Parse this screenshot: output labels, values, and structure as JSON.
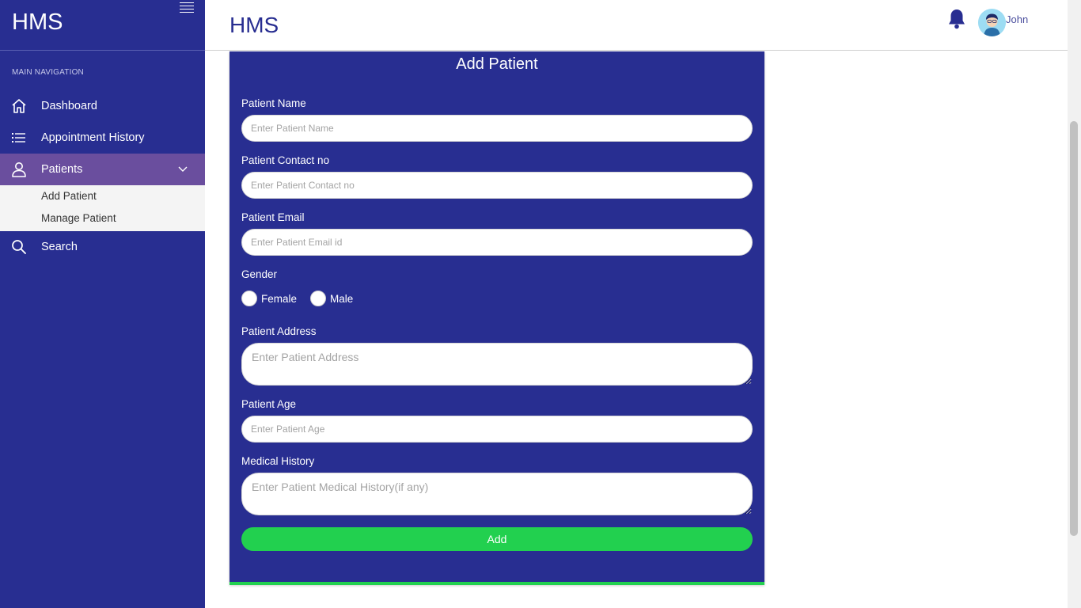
{
  "app": {
    "brand": "HMS",
    "page_title": "HMS"
  },
  "sidebar": {
    "heading": "MAIN NAVIGATION",
    "items": [
      {
        "label": "Dashboard",
        "icon": "home-icon"
      },
      {
        "label": "Appointment History",
        "icon": "list-icon"
      },
      {
        "label": "Patients",
        "icon": "user-icon",
        "active": true
      },
      {
        "label": "Search",
        "icon": "search-icon"
      }
    ],
    "submenu": [
      {
        "label": "Add Patient"
      },
      {
        "label": "Manage Patient"
      }
    ]
  },
  "header": {
    "username": "John",
    "notification_icon": "bell-icon",
    "avatar_icon": "avatar-icon"
  },
  "form": {
    "title": "Add Patient",
    "patient_name": {
      "label": "Patient Name",
      "placeholder": "Enter Patient Name"
    },
    "contact": {
      "label": "Patient Contact no",
      "placeholder": "Enter Patient Contact no"
    },
    "email": {
      "label": "Patient Email",
      "placeholder": "Enter Patient Email id"
    },
    "gender": {
      "label": "Gender",
      "options": [
        "Female",
        "Male"
      ]
    },
    "address": {
      "label": "Patient Address",
      "placeholder": "Enter Patient Address"
    },
    "age": {
      "label": "Patient Age",
      "placeholder": "Enter Patient Age"
    },
    "medical_history": {
      "label": "Medical History",
      "placeholder": "Enter Patient Medical History(if any)"
    },
    "submit_label": "Add"
  },
  "colors": {
    "sidebar": "#282e91",
    "active_item": "#6a4e9e",
    "accent_green": "#22d04f"
  }
}
